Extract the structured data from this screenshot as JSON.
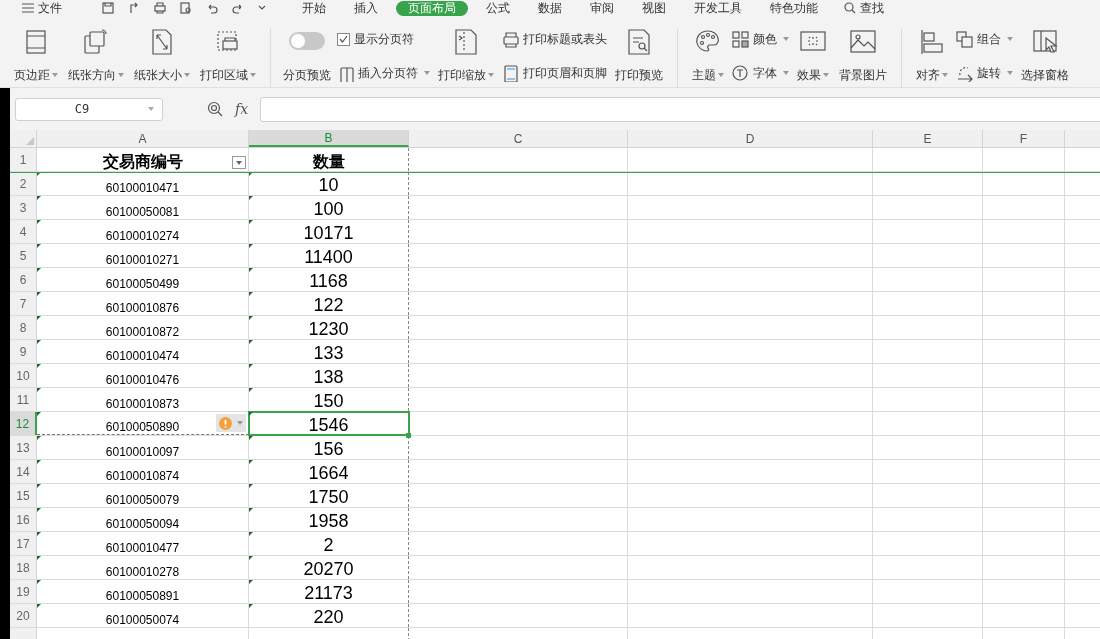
{
  "menu": {
    "file": "文件",
    "tabs": [
      {
        "label": "开始",
        "selected": false
      },
      {
        "label": "插入",
        "selected": false
      },
      {
        "label": "页面布局",
        "selected": true
      },
      {
        "label": "公式",
        "selected": false
      },
      {
        "label": "数据",
        "selected": false
      },
      {
        "label": "审阅",
        "selected": false
      },
      {
        "label": "视图",
        "selected": false
      },
      {
        "label": "开发工具",
        "selected": false
      },
      {
        "label": "特色功能",
        "selected": false
      }
    ],
    "search": "查找"
  },
  "ribbon": [
    {
      "items": [
        {
          "kind": "large",
          "label": "页边距",
          "dropdown": true
        },
        {
          "kind": "large",
          "label": "纸张方向",
          "dropdown": true
        },
        {
          "kind": "large",
          "label": "纸张大小",
          "dropdown": true
        },
        {
          "kind": "large",
          "label": "打印区域",
          "dropdown": true
        }
      ]
    },
    {
      "items": [
        {
          "kind": "toggle",
          "label": "分页预览",
          "on": false
        },
        {
          "kind": "stack",
          "items": [
            {
              "kind": "checkbox",
              "label": "显示分页符",
              "checked": true
            },
            {
              "kind": "small",
              "label": "插入分页符",
              "dropdown": true
            }
          ]
        },
        {
          "kind": "large",
          "label": "打印缩放",
          "dropdown": true
        },
        {
          "kind": "stack",
          "items": [
            {
              "kind": "small",
              "label": "打印标题或表头",
              "dropdown": false
            },
            {
              "kind": "small",
              "label": "打印页眉和页脚",
              "dropdown": false
            }
          ]
        },
        {
          "kind": "large",
          "label": "打印预览",
          "dropdown": false
        }
      ]
    },
    {
      "items": [
        {
          "kind": "large",
          "label": "主题",
          "dropdown": true
        },
        {
          "kind": "stack",
          "items": [
            {
              "kind": "small",
              "label": "颜色",
              "dropdown": true
            },
            {
              "kind": "small",
              "label": "字体",
              "dropdown": true
            }
          ]
        },
        {
          "kind": "large",
          "label": "效果",
          "dropdown": true
        },
        {
          "kind": "large",
          "label": "背景图片",
          "dropdown": false
        }
      ]
    },
    {
      "items": [
        {
          "kind": "large",
          "label": "对齐",
          "dropdown": true
        },
        {
          "kind": "stack",
          "items": [
            {
              "kind": "small",
              "label": "组合",
              "dropdown": true
            },
            {
              "kind": "small",
              "label": "旋转",
              "dropdown": true
            }
          ]
        },
        {
          "kind": "large",
          "label": "选择窗格",
          "dropdown": false
        }
      ]
    }
  ],
  "formula_bar": {
    "name_box": "C9",
    "fx": "fx"
  },
  "sheet": {
    "columns": [
      {
        "label": "A",
        "selected": false,
        "filter": true
      },
      {
        "label": "B",
        "selected": true,
        "filter": false
      },
      {
        "label": "C",
        "selected": false,
        "filter": false
      },
      {
        "label": "D",
        "selected": false,
        "filter": false
      },
      {
        "label": "E",
        "selected": false,
        "filter": false
      },
      {
        "label": "F",
        "selected": false,
        "filter": false
      }
    ],
    "rows": [
      {
        "number": "1",
        "a": "交易商编号",
        "b": "数量",
        "kind": "header",
        "selected": false,
        "warning": false
      },
      {
        "number": "2",
        "a": "60100010471",
        "b": "10",
        "kind": "data",
        "selected": false,
        "warning": false
      },
      {
        "number": "3",
        "a": "60100050081",
        "b": "100",
        "kind": "data",
        "selected": false,
        "warning": false
      },
      {
        "number": "4",
        "a": "60100010274",
        "b": "10171",
        "kind": "data",
        "selected": false,
        "warning": false
      },
      {
        "number": "5",
        "a": "60100010271",
        "b": "11400",
        "kind": "data",
        "selected": false,
        "warning": false
      },
      {
        "number": "6",
        "a": "60100050499",
        "b": "1168",
        "kind": "data",
        "selected": false,
        "warning": false
      },
      {
        "number": "7",
        "a": "60100010876",
        "b": "122",
        "kind": "data",
        "selected": false,
        "warning": false
      },
      {
        "number": "8",
        "a": "60100010872",
        "b": "1230",
        "kind": "data",
        "selected": false,
        "warning": false
      },
      {
        "number": "9",
        "a": "60100010474",
        "b": "133",
        "kind": "data",
        "selected": false,
        "warning": false
      },
      {
        "number": "10",
        "a": "60100010476",
        "b": "138",
        "kind": "data",
        "selected": false,
        "warning": false
      },
      {
        "number": "11",
        "a": "60100010873",
        "b": "150",
        "kind": "data",
        "selected": false,
        "warning": false
      },
      {
        "number": "12",
        "a": "60100050890",
        "b": "1546",
        "kind": "data",
        "selected": true,
        "warning": true
      },
      {
        "number": "13",
        "a": "60100010097",
        "b": "156",
        "kind": "data",
        "selected": false,
        "warning": false
      },
      {
        "number": "14",
        "a": "60100010874",
        "b": "1664",
        "kind": "data",
        "selected": false,
        "warning": false
      },
      {
        "number": "15",
        "a": "60100050079",
        "b": "1750",
        "kind": "data",
        "selected": false,
        "warning": false
      },
      {
        "number": "16",
        "a": "60100050094",
        "b": "1958",
        "kind": "data",
        "selected": false,
        "warning": false
      },
      {
        "number": "17",
        "a": "60100010477",
        "b": "2",
        "kind": "data",
        "selected": false,
        "warning": false
      },
      {
        "number": "18",
        "a": "60100010278",
        "b": "20270",
        "kind": "data",
        "selected": false,
        "warning": false
      },
      {
        "number": "19",
        "a": "60100050891",
        "b": "21173",
        "kind": "data",
        "selected": false,
        "warning": false
      },
      {
        "number": "20",
        "a": "60100050074",
        "b": "220",
        "kind": "data",
        "selected": false,
        "warning": false
      }
    ]
  }
}
